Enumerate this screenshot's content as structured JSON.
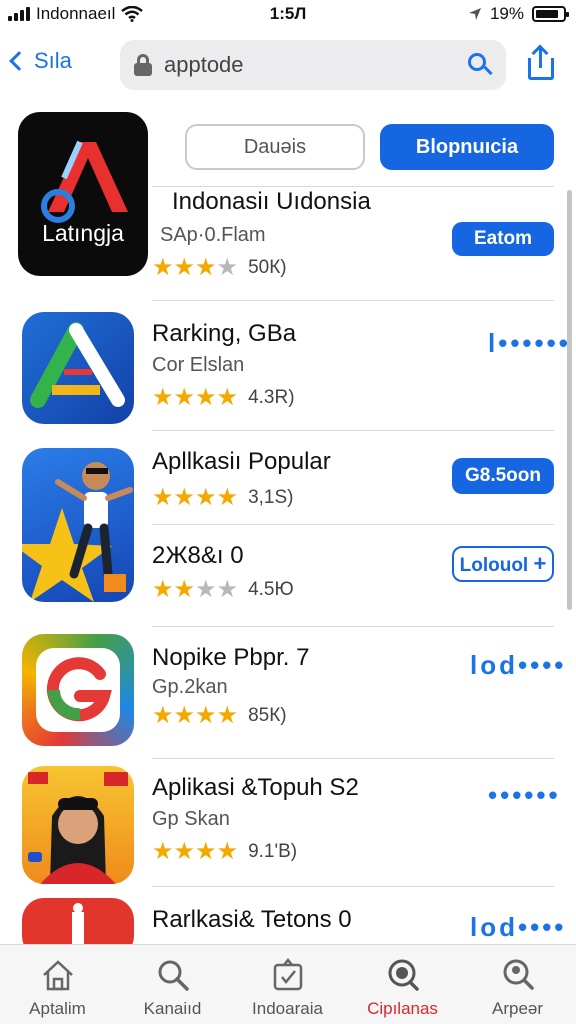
{
  "status_bar": {
    "carrier": "Indonnaeıl",
    "time": "1:5Л",
    "battery": "19%"
  },
  "nav": {
    "back_label": "Sıla",
    "search_term": "apptode"
  },
  "segments": {
    "left": "Dauəis",
    "right": "Blopnuıcia"
  },
  "apps": [
    {
      "title": "Indonasiı Uıdonsia",
      "subtitle": "SAp·0.Flam",
      "stars": 3,
      "rating_count": "50К)",
      "action_label": "Eatom",
      "action_style": "filled",
      "icon_text": "Latıngja"
    },
    {
      "title": "Rarking, GBa",
      "subtitle": "Cor Elslan",
      "stars": 4,
      "rating_count": "4.3R)",
      "action_label": "l••••••",
      "action_style": "dots"
    },
    {
      "title": "Apllkasiı Popular",
      "subtitle": "",
      "stars": 4,
      "rating_count": "3,1S)",
      "action_label": "G8.5oon",
      "action_style": "filled"
    },
    {
      "title": "2Ж8&ı 0",
      "subtitle": "",
      "stars": 2,
      "rating_count": "4.5Ю",
      "action_label": "Lolouol",
      "action_style": "outline"
    },
    {
      "title": "Nopike Pbpr. 7",
      "subtitle": "Gp.2kan",
      "stars": 4,
      "rating_count": "85К)",
      "action_label": "lod••••",
      "action_style": "dots"
    },
    {
      "title": "Aplikasi &Topuh S2",
      "subtitle": "Gp Skan",
      "stars": 4,
      "rating_count": "9.1'B)",
      "action_label": "••••••",
      "action_style": "dots"
    },
    {
      "title": "Rarlkasi& Tetons 0",
      "subtitle": "",
      "stars": 0,
      "rating_count": "",
      "action_label": "lod••••",
      "action_style": "dots"
    }
  ],
  "tabs": [
    {
      "label": "Aptalim",
      "icon": "home-icon"
    },
    {
      "label": "Kanaiıd",
      "icon": "search-icon"
    },
    {
      "label": "Indoaraia",
      "icon": "apps-icon"
    },
    {
      "label": "Cipılanas",
      "icon": "discover-icon",
      "active": true
    },
    {
      "label": "Arpeər",
      "icon": "profile-search-icon"
    }
  ],
  "colors": {
    "accent": "#1566e0",
    "star": "#f2a900",
    "active_tab": "#d62a2a"
  }
}
